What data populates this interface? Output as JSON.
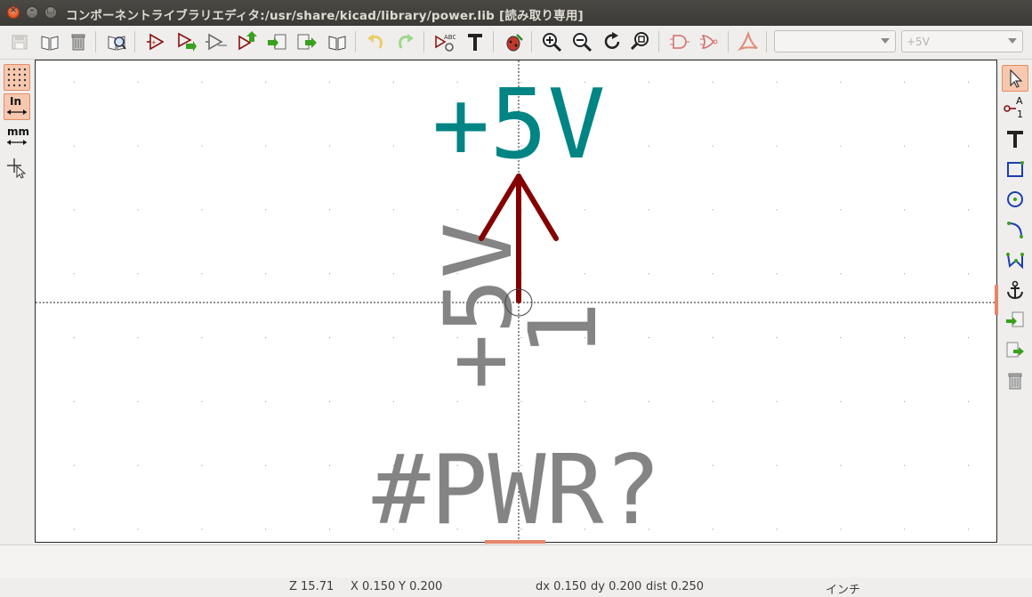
{
  "window": {
    "title": "コンポーネントライブラリエディタ:/usr/share/kicad/library/power.lib [読み取り専用]"
  },
  "toolbar": {
    "icons": [
      "save-library-icon",
      "select-library-icon",
      "delete-part-icon",
      "library-browser-icon",
      "new-component-icon",
      "load-component-icon",
      "import-component-icon",
      "export-component-icon",
      "save-to-library-icon",
      "save-to-new-library-icon",
      "view-doc-icon",
      "undo-icon",
      "redo-icon",
      "edit-fields-icon",
      "text-tool-icon",
      "erc-check-icon",
      "zoom-in-icon",
      "zoom-out-icon",
      "zoom-redraw-icon",
      "zoom-fit-icon",
      "deMorgan-normal-icon",
      "deMorgan-convert-icon",
      "datasheet-pdf-icon"
    ],
    "unit_select": "",
    "part_select": "+5V"
  },
  "left_toolbar": {
    "units_in_label": "In",
    "units_mm_label": "mm"
  },
  "right_toolbar": {
    "pin_label": "A",
    "pin_number": "1"
  },
  "canvas": {
    "value_text": "+5V",
    "pin_name_text": "+5V",
    "pin_number_text": "1",
    "reference_text": "#PWR?",
    "colors": {
      "value": "#008484",
      "pin_body": "#840000",
      "field_grey": "#848484"
    }
  },
  "status": {
    "zoom": "Z 15.71",
    "x": "X 0.150",
    "y": "Y 0.200",
    "dx": "dx 0.150",
    "dy": "dy 0.200",
    "dist": "dist 0.250",
    "units": "インチ"
  }
}
